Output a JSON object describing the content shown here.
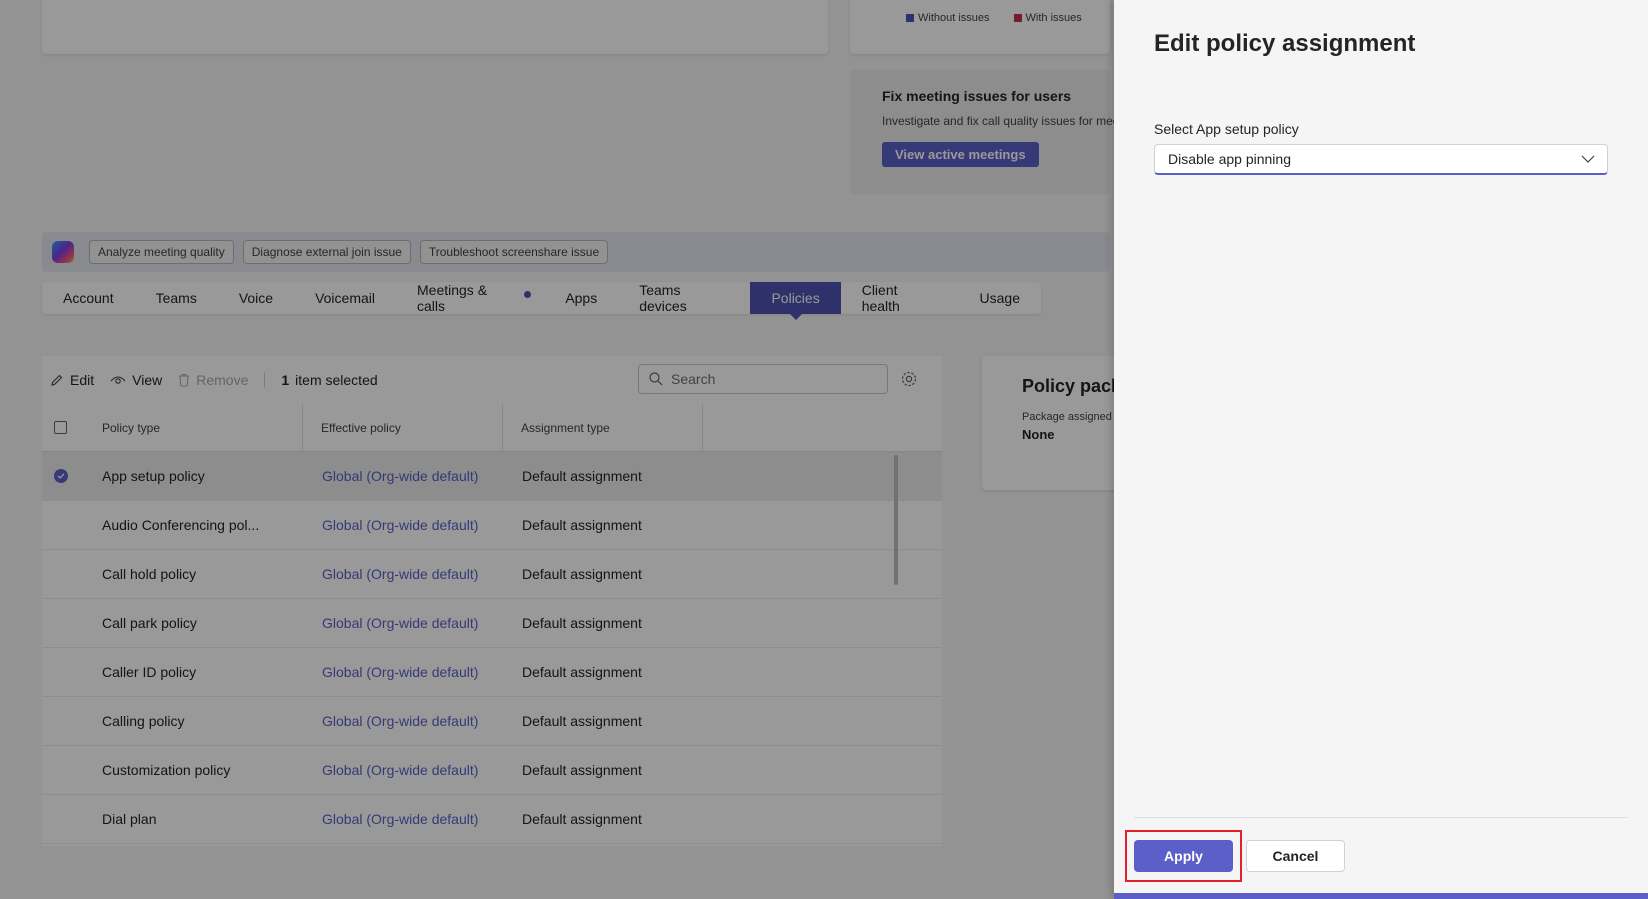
{
  "legend": {
    "without": "Without issues",
    "with": "With issues",
    "without_color": "#4f52b2",
    "with_color": "#c4314b"
  },
  "fix_card": {
    "title": "Fix meeting issues for users",
    "desc": "Investigate and fix call quality issues for mee",
    "button": "View active meetings"
  },
  "copilot_chips": [
    "Analyze meeting quality",
    "Diagnose external join issue",
    "Troubleshoot screenshare issue"
  ],
  "tabs": [
    "Account",
    "Teams",
    "Voice",
    "Voicemail",
    "Meetings & calls",
    "Apps",
    "Teams devices",
    "Policies",
    "Client health",
    "Usage"
  ],
  "toolbar": {
    "edit": "Edit",
    "view": "View",
    "remove": "Remove",
    "selected_count": "1",
    "selected_text": "item selected",
    "search_placeholder": "Search"
  },
  "table": {
    "headers": [
      "Policy type",
      "Effective policy",
      "Assignment type"
    ],
    "rows": [
      {
        "type": "App setup policy",
        "effective": "Global (Org-wide default)",
        "assignment": "Default assignment"
      },
      {
        "type": "Audio Conferencing pol...",
        "effective": "Global (Org-wide default)",
        "assignment": "Default assignment"
      },
      {
        "type": "Call hold policy",
        "effective": "Global (Org-wide default)",
        "assignment": "Default assignment"
      },
      {
        "type": "Call park policy",
        "effective": "Global (Org-wide default)",
        "assignment": "Default assignment"
      },
      {
        "type": "Caller ID policy",
        "effective": "Global (Org-wide default)",
        "assignment": "Default assignment"
      },
      {
        "type": "Calling policy",
        "effective": "Global (Org-wide default)",
        "assignment": "Default assignment"
      },
      {
        "type": "Customization policy",
        "effective": "Global (Org-wide default)",
        "assignment": "Default assignment"
      },
      {
        "type": "Dial plan",
        "effective": "Global (Org-wide default)",
        "assignment": "Default assignment"
      }
    ]
  },
  "package_card": {
    "title": "Policy pack",
    "label": "Package assigned",
    "value": "None"
  },
  "panel": {
    "title": "Edit policy assignment",
    "field_label": "Select App setup policy",
    "selected_value": "Disable app pinning",
    "apply": "Apply",
    "cancel": "Cancel"
  },
  "colors": {
    "accent": "#5b5fc7",
    "highlight": "#e3202c"
  }
}
